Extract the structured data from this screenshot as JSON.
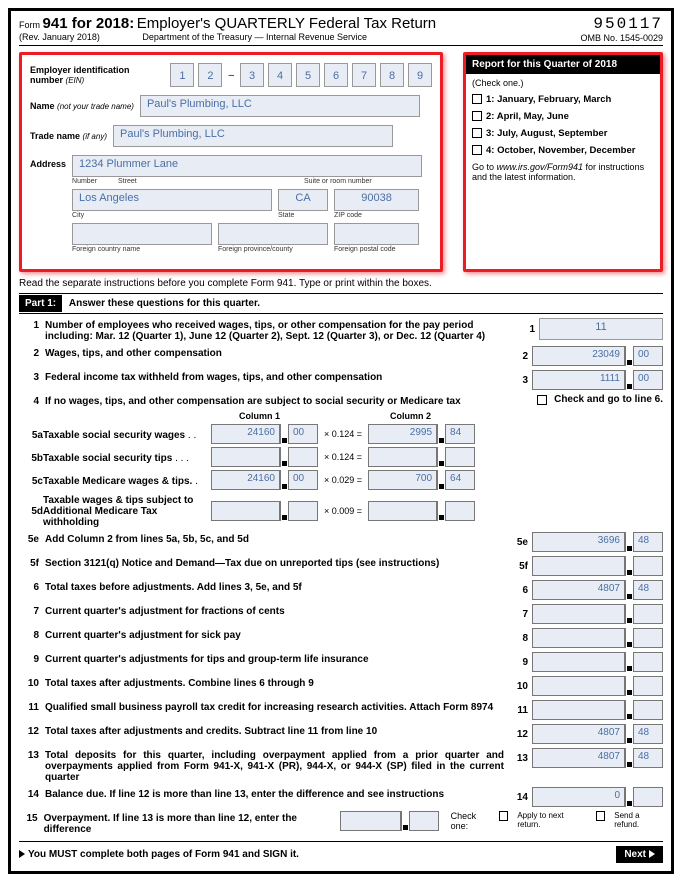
{
  "header": {
    "form_prefix": "Form",
    "form_title": "941 for 2018:",
    "form_desc": "Employer's QUARTERLY Federal Tax Return",
    "rev": "(Rev. January 2018)",
    "dept": "Department of the Treasury — Internal Revenue Service",
    "formnum": "950117",
    "omb": "OMB No. 1545-0029"
  },
  "employer": {
    "ein_label": "Employer identification number",
    "ein_sub": "(EIN)",
    "ein": [
      "1",
      "2",
      "3",
      "4",
      "5",
      "6",
      "7",
      "8",
      "9"
    ],
    "name_label": "Name",
    "name_sub": "(not your trade name)",
    "name": "Paul's Plumbing, LLC",
    "trade_label": "Trade name",
    "trade_sub": "(if any)",
    "trade": "Paul's Plumbing, LLC",
    "addr_label": "Address",
    "street": "1234 Plummer Lane",
    "city": "Los Angeles",
    "state": "CA",
    "zip": "90038",
    "l_number": "Number",
    "l_street": "Street",
    "l_suite": "Suite or room number",
    "l_city": "City",
    "l_state": "State",
    "l_zip": "ZIP code",
    "l_fcountry": "Foreign country name",
    "l_fprov": "Foreign province/county",
    "l_fpost": "Foreign postal code"
  },
  "quarter": {
    "header": "Report for this Quarter of 2018",
    "sub": "(Check one.)",
    "opt1": "1: January, February, March",
    "opt2": "2: April, May, June",
    "opt3": "3: July, August, September",
    "opt4": "4: October, November, December",
    "foot1": "Go to ",
    "foot_url": "www.irs.gov/Form941",
    "foot2": " for instructions and the latest information."
  },
  "instr": "Read the separate instructions before you complete Form 941. Type or print within the boxes.",
  "part1": {
    "label": "Part 1:",
    "text": "Answer these questions for this quarter."
  },
  "lines": {
    "l1": {
      "t": "Number of employees who received wages, tips, or other compensation for the pay period including: Mar. 12 (Quarter 1), June 12 (Quarter 2), Sept. 12 (Quarter 3), or Dec. 12 (Quarter 4)",
      "v": "11"
    },
    "l2": {
      "t": "Wages, tips, and other compensation",
      "d": "23049",
      "c": "00"
    },
    "l3": {
      "t": "Federal income tax withheld from wages, tips, and other compensation",
      "d": "1111",
      "c": "00"
    },
    "l4": {
      "t": "If no wages, tips, and other compensation are subject to social security or Medicare tax",
      "chk": "Check and go to line 6."
    },
    "col1": "Column 1",
    "col2": "Column 2",
    "l5a": {
      "t": "Taxable social security wages",
      "c1d": "24160",
      "c1c": "00",
      "m": "× 0.124 =",
      "c2d": "2995",
      "c2c": "84"
    },
    "l5b": {
      "t": "Taxable social security tips",
      "c1d": "",
      "c1c": "",
      "m": "× 0.124 =",
      "c2d": "",
      "c2c": ""
    },
    "l5c": {
      "t": "Taxable Medicare wages & tips.",
      "c1d": "24160",
      "c1c": "00",
      "m": "× 0.029 =",
      "c2d": "700",
      "c2c": "64"
    },
    "l5d": {
      "t": "Taxable wages & tips subject to Additional Medicare Tax withholding",
      "c1d": "",
      "c1c": "",
      "m": "× 0.009 =",
      "c2d": "",
      "c2c": ""
    },
    "l5e": {
      "t": "Add Column 2 from lines 5a, 5b, 5c, and 5d",
      "d": "3696",
      "c": "48"
    },
    "l5f": {
      "t": "Section 3121(q) Notice and Demand—Tax due on unreported tips (see instructions)",
      "d": "",
      "c": ""
    },
    "l6": {
      "t": "Total taxes before adjustments. Add lines 3, 5e, and 5f",
      "d": "4807",
      "c": "48"
    },
    "l7": {
      "t": "Current quarter's adjustment for fractions of cents",
      "d": "",
      "c": ""
    },
    "l8": {
      "t": "Current quarter's adjustment for sick pay",
      "d": "",
      "c": ""
    },
    "l9": {
      "t": "Current quarter's adjustments for tips and group-term life insurance",
      "d": "",
      "c": ""
    },
    "l10": {
      "t": "Total taxes after adjustments. Combine lines 6 through 9",
      "d": "",
      "c": ""
    },
    "l11": {
      "t": "Qualified small business payroll tax credit for increasing research activities. Attach Form 8974",
      "d": "",
      "c": ""
    },
    "l12": {
      "t": "Total taxes after adjustments and credits. Subtract line 11 from line 10",
      "d": "4807",
      "c": "48"
    },
    "l13": {
      "t": "Total deposits for this quarter, including overpayment applied from a prior quarter and overpayments applied from Form 941-X, 941-X (PR), 944-X, or 944-X (SP) filed in the current quarter",
      "d": "4807",
      "c": "48"
    },
    "l14": {
      "t": "Balance due. If line 12 is more than line 13, enter the difference and see instructions",
      "d": "0",
      "c": ""
    },
    "l15": {
      "t": "Overpayment. If line 13 is more than line 12, enter the difference",
      "d": "",
      "c": "",
      "chk": "Check one:",
      "o1": "Apply to next return.",
      "o2": "Send a refund."
    }
  },
  "footer": {
    "must": "You MUST complete both pages of Form 941 and SIGN it.",
    "next": "Next"
  }
}
